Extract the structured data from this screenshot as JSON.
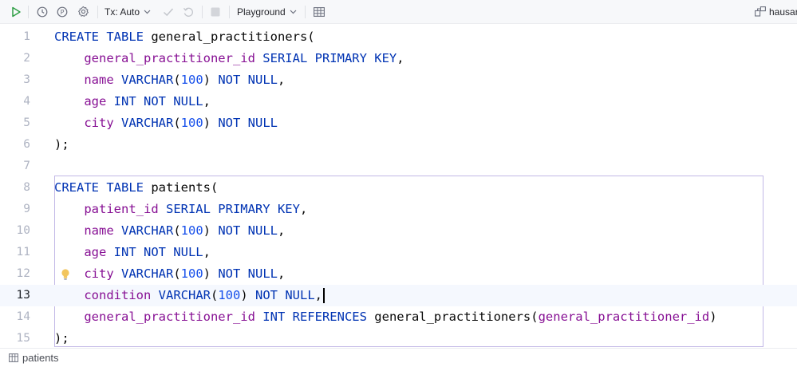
{
  "toolbar": {
    "tx_label": "Tx: Auto",
    "playground_label": "Playground",
    "user_label": "hausar"
  },
  "editor": {
    "lines": [
      {
        "n": "1",
        "tokens": [
          [
            "kw",
            "CREATE TABLE "
          ],
          [
            "plain",
            "general_practitioners("
          ]
        ]
      },
      {
        "n": "2",
        "tokens": [
          [
            "plain",
            "    "
          ],
          [
            "fld",
            "general_practitioner_id "
          ],
          [
            "kw",
            "SERIAL PRIMARY KEY"
          ],
          [
            "plain",
            ","
          ]
        ]
      },
      {
        "n": "3",
        "tokens": [
          [
            "plain",
            "    "
          ],
          [
            "fld",
            "name "
          ],
          [
            "kw",
            "VARCHAR"
          ],
          [
            "plain",
            "("
          ],
          [
            "num",
            "100"
          ],
          [
            "plain",
            ") "
          ],
          [
            "kw",
            "NOT NULL"
          ],
          [
            "plain",
            ","
          ]
        ]
      },
      {
        "n": "4",
        "tokens": [
          [
            "plain",
            "    "
          ],
          [
            "fld",
            "age "
          ],
          [
            "kw",
            "INT NOT NULL"
          ],
          [
            "plain",
            ","
          ]
        ]
      },
      {
        "n": "5",
        "tokens": [
          [
            "plain",
            "    "
          ],
          [
            "fld",
            "city "
          ],
          [
            "kw",
            "VARCHAR"
          ],
          [
            "plain",
            "("
          ],
          [
            "num",
            "100"
          ],
          [
            "plain",
            ") "
          ],
          [
            "kw",
            "NOT NULL"
          ]
        ]
      },
      {
        "n": "6",
        "tokens": [
          [
            "plain",
            ");"
          ]
        ]
      },
      {
        "n": "7",
        "tokens": []
      },
      {
        "n": "8",
        "tokens": [
          [
            "kw",
            "CREATE TABLE "
          ],
          [
            "plain",
            "patients("
          ]
        ]
      },
      {
        "n": "9",
        "tokens": [
          [
            "plain",
            "    "
          ],
          [
            "fld",
            "patient_id "
          ],
          [
            "kw",
            "SERIAL PRIMARY KEY"
          ],
          [
            "plain",
            ","
          ]
        ]
      },
      {
        "n": "10",
        "tokens": [
          [
            "plain",
            "    "
          ],
          [
            "fld",
            "name "
          ],
          [
            "kw",
            "VARCHAR"
          ],
          [
            "plain",
            "("
          ],
          [
            "num",
            "100"
          ],
          [
            "plain",
            ") "
          ],
          [
            "kw",
            "NOT NULL"
          ],
          [
            "plain",
            ","
          ]
        ]
      },
      {
        "n": "11",
        "tokens": [
          [
            "plain",
            "    "
          ],
          [
            "fld",
            "age "
          ],
          [
            "kw",
            "INT NOT NULL"
          ],
          [
            "plain",
            ","
          ]
        ]
      },
      {
        "n": "12",
        "tokens": [
          [
            "plain",
            "    "
          ],
          [
            "fld",
            "city "
          ],
          [
            "kw",
            "VARCHAR"
          ],
          [
            "plain",
            "("
          ],
          [
            "num",
            "100"
          ],
          [
            "plain",
            ") "
          ],
          [
            "kw",
            "NOT NULL"
          ],
          [
            "plain",
            ","
          ]
        ]
      },
      {
        "n": "13",
        "tokens": [
          [
            "plain",
            "    "
          ],
          [
            "fld",
            "condition "
          ],
          [
            "kw",
            "VARCHAR"
          ],
          [
            "plain",
            "("
          ],
          [
            "num",
            "100"
          ],
          [
            "plain",
            ") "
          ],
          [
            "kw",
            "NOT NULL"
          ],
          [
            "plain",
            ","
          ]
        ]
      },
      {
        "n": "14",
        "tokens": [
          [
            "plain",
            "    "
          ],
          [
            "fld",
            "general_practitioner_id "
          ],
          [
            "kw",
            "INT REFERENCES "
          ],
          [
            "plain",
            "general_practitioners("
          ],
          [
            "fld",
            "general_practitioner_id"
          ],
          [
            "plain",
            ")"
          ]
        ]
      },
      {
        "n": "15",
        "tokens": [
          [
            "plain",
            ");"
          ]
        ]
      }
    ],
    "current_line": "13"
  },
  "status": {
    "context_label": "patients"
  },
  "colors": {
    "keyword": "#0033b3",
    "field": "#871094",
    "number": "#1750eb",
    "run_green": "#2e9e44",
    "bulb_yellow": "#f2c55c"
  }
}
